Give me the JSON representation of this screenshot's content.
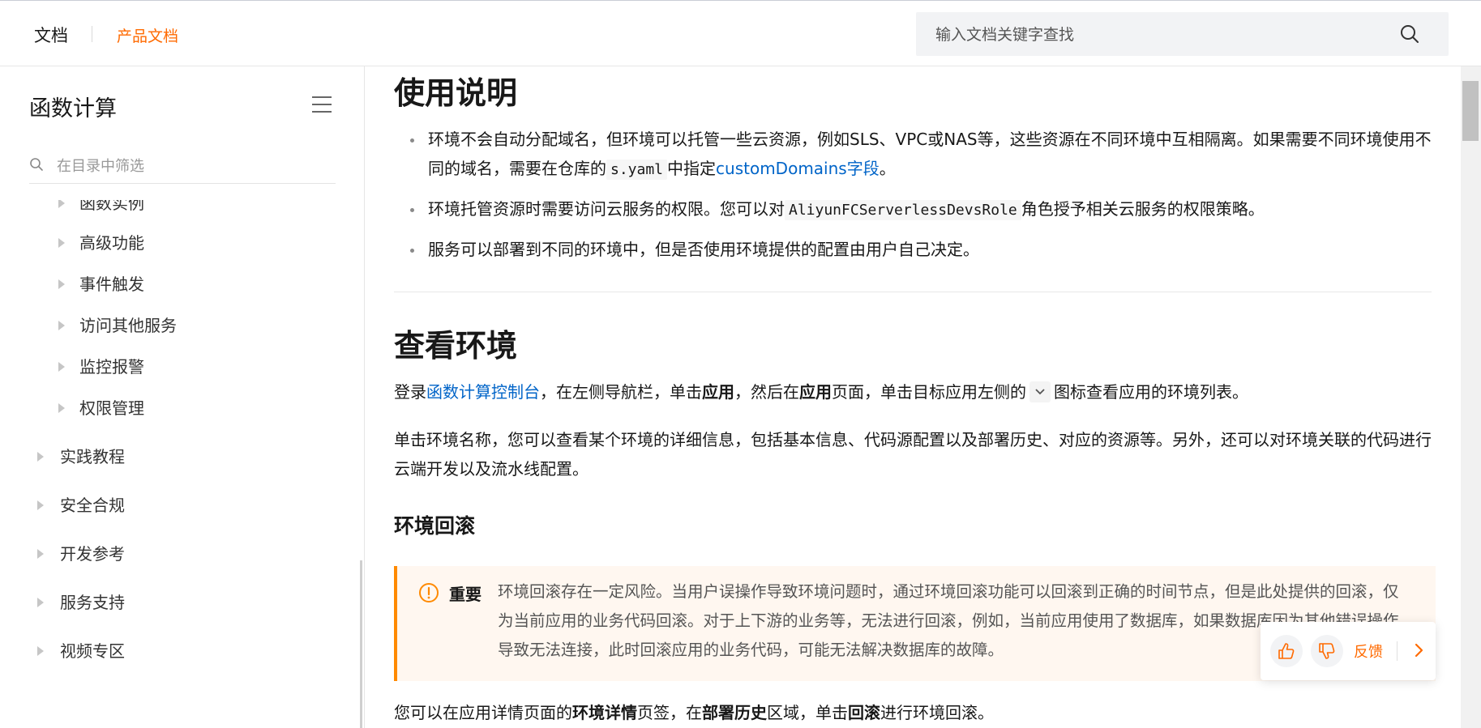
{
  "header": {
    "brand": "文档",
    "product_docs": "产品文档",
    "search_placeholder": "输入文档关键字查找"
  },
  "sidebar": {
    "title": "函数计算",
    "filter_placeholder": "在目录中筛选",
    "items": [
      {
        "label": "函数实例"
      },
      {
        "label": "高级功能"
      },
      {
        "label": "事件触发"
      },
      {
        "label": "访问其他服务"
      },
      {
        "label": "监控报警"
      },
      {
        "label": "权限管理"
      },
      {
        "label": "实践教程"
      },
      {
        "label": "安全合规"
      },
      {
        "label": "开发参考"
      },
      {
        "label": "服务支持"
      },
      {
        "label": "视频专区"
      }
    ]
  },
  "main": {
    "usage_heading": "使用说明",
    "bullet1_a": "环境不会自动分配域名，但环境可以托管一些云资源，例如SLS、VPC或NAS等，这些资源在不同环境中互相隔离。如果需要不同环境使用不同的域名，需要在仓库的",
    "bullet1_code": "s.yaml",
    "bullet1_b": "中指定",
    "bullet1_link": "customDomains字段",
    "bullet1_c": "。",
    "bullet2_a": "环境托管资源时需要访问云服务的权限。您可以对",
    "bullet2_code": "AliyunFCServerlessDevsRole",
    "bullet2_b": "角色授予相关云服务的权限策略。",
    "bullet3": "服务可以部署到不同的环境中，但是否使用环境提供的配置由用户自己决定。",
    "view_heading": "查看环境",
    "view_p1_a": "登录",
    "view_p1_link": "函数计算控制台",
    "view_p1_b": "，在左侧导航栏，单击",
    "view_p1_bold1": "应用",
    "view_p1_c": "，然后在",
    "view_p1_bold2": "应用",
    "view_p1_d": "页面，单击目标应用左侧的",
    "view_p1_e": "图标查看应用的环境列表。",
    "view_p2": "单击环境名称，您可以查看某个环境的详细信息，包括基本信息、代码源配置以及部署历史、对应的资源等。另外，还可以对环境关联的代码进行云端开发以及流水线配置。",
    "rollback_heading": "环境回滚",
    "notice_label": "重要",
    "notice_text": "环境回滚存在一定风险。当用户误操作导致环境问题时，通过环境回滚功能可以回滚到正确的时间节点，但是此处提供的回滚，仅为当前应用的业务代码回滚。对于上下游的业务等，无法进行回滚，例如，当前应用使用了数据库，如果数据库因为其他错误操作导致无法连接，此时回滚应用的业务代码，可能无法解决数据库的故障。",
    "last_a": "您可以在应用详情页面的",
    "last_bold1": "环境详情",
    "last_b": "页签，在",
    "last_bold2": "部署历史",
    "last_c": "区域，单击",
    "last_bold3": "回滚",
    "last_d": "进行环境回滚。"
  },
  "feedback": {
    "label": "反馈"
  },
  "colors": {
    "accent": "#ff6a00",
    "link": "#0064c8",
    "notice_border": "#ff8a00",
    "notice_bg": "#fff7f0"
  },
  "icons": [
    "search-icon",
    "menu-icon",
    "filter-search-icon",
    "chevron-down-icon",
    "warning-circle-icon",
    "thumbs-up-icon",
    "thumbs-down-icon",
    "chevron-right-icon"
  ]
}
